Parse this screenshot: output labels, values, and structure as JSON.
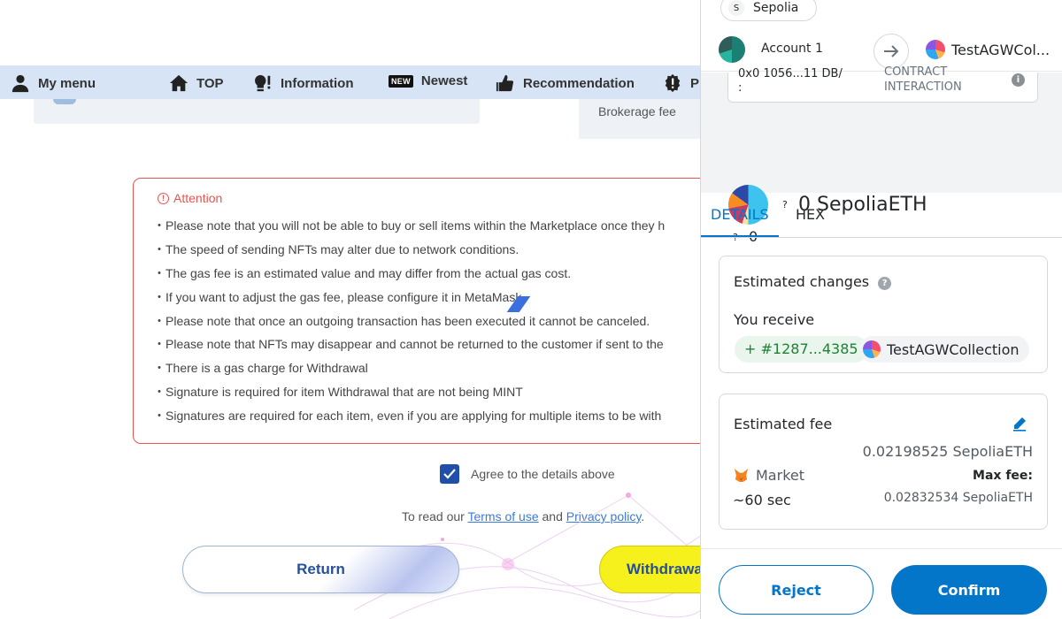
{
  "nav": {
    "items": [
      {
        "label": "My menu",
        "icon": "person-icon"
      },
      {
        "label": "TOP",
        "icon": "home-icon"
      },
      {
        "label": "Information",
        "icon": "bulb-exclamation-icon"
      },
      {
        "label": "Newest",
        "icon": "new-badge-icon",
        "badge": "NEW"
      },
      {
        "label": "Recommendation",
        "icon": "thumbs-up-icon"
      },
      {
        "label": "P",
        "icon": "gear-exclamation-icon"
      }
    ]
  },
  "background": {
    "brokerage_fee_label": "Brokerage fee",
    "attention": {
      "title": "Attention",
      "items": [
        "Please note that you will not be able to buy or sell items within the Marketplace once they h",
        "The speed of sending NFTs may alter due to network conditions.",
        "The gas fee is an estimated value and may differ from the actual gas cost.",
        "If you want to adjust the gas fee, please configure it in MetaMask.",
        "Please note that once an outgoing transaction has been executed it cannot be canceled.",
        "Please note that NFTs may disappear and cannot be returned to the customer if sent to the",
        "There is a gas charge for Withdrawal",
        "Signature is required for item Withdrawal that are not being MINT",
        "Signatures are required for each item, even if you are applying for multiple items to be with"
      ]
    },
    "agree_label": "Agree to the details above",
    "agree_checked": true,
    "terms": {
      "prefix": "To read our ",
      "terms_link": "Terms of use",
      "and": " and ",
      "privacy_link": "Privacy policy",
      "suffix": "."
    },
    "return_button": "Return",
    "withdraw_button": "Withdrawal"
  },
  "metamask": {
    "network_initial": "S",
    "network": "Sepolia",
    "account": "Account 1",
    "contract_name": "TestAGWCol...",
    "contract_address_fragment": "0x0 1056...11 DB/",
    "contract_address_suffix": ":",
    "contract_type_top": "CONTRACT",
    "contract_type": "INTERACTION",
    "amount": "0 SepoliaETH",
    "fiat": "0",
    "unknown_mark": "?",
    "tabs": [
      "DETAILS",
      "HEX"
    ],
    "active_tab": "DETAILS",
    "estimated_changes": {
      "title": "Estimated changes",
      "receive_label": "You receive",
      "token_id": "+ #1287...4385",
      "collection": "TestAGWCollection"
    },
    "estimated_fee": {
      "title": "Estimated fee",
      "fee": "0.02198525 SepoliaETH",
      "speed": "Market",
      "time": "~60 sec",
      "max_fee_label": "Max fee:",
      "max_fee": "0.02832534 SepoliaETH"
    },
    "reject_button": "Reject",
    "confirm_button": "Confirm",
    "colors": {
      "primary": "#0376c9",
      "success": "#1c8234",
      "attention": "#e8544e",
      "withdraw": "#f6f01c"
    }
  }
}
